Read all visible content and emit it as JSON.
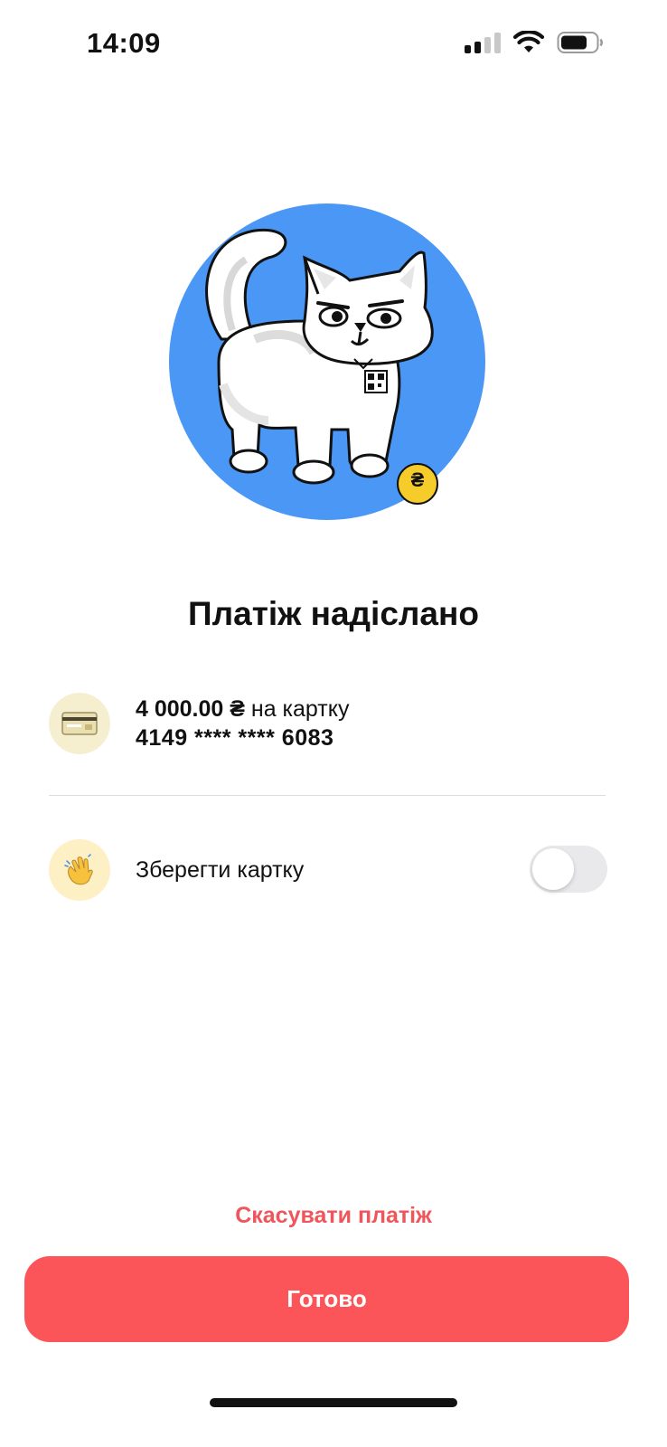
{
  "status_bar": {
    "time": "14:09",
    "icons": [
      "cellular-signal-icon",
      "wifi-icon",
      "battery-icon"
    ]
  },
  "illustration": {
    "description_icon": "cat-illustration",
    "coin_symbol": "₴",
    "colors": {
      "circle": "#4a97f5",
      "coin": "#f5cc2a"
    }
  },
  "title": "Платіж надіслано",
  "payment": {
    "amount": "4 000.00 ₴",
    "to_card_text": " на картку",
    "card_number": "4149 **** **** 6083",
    "icon": "credit-card-icon"
  },
  "save_card": {
    "label": "Зберегти картку",
    "icon": "waving-hand-icon",
    "toggle_on": false
  },
  "actions": {
    "cancel_label": "Скасувати платіж",
    "done_label": "Готово"
  },
  "colors": {
    "accent": "#fb555a",
    "cancel_text": "#f0555b"
  }
}
